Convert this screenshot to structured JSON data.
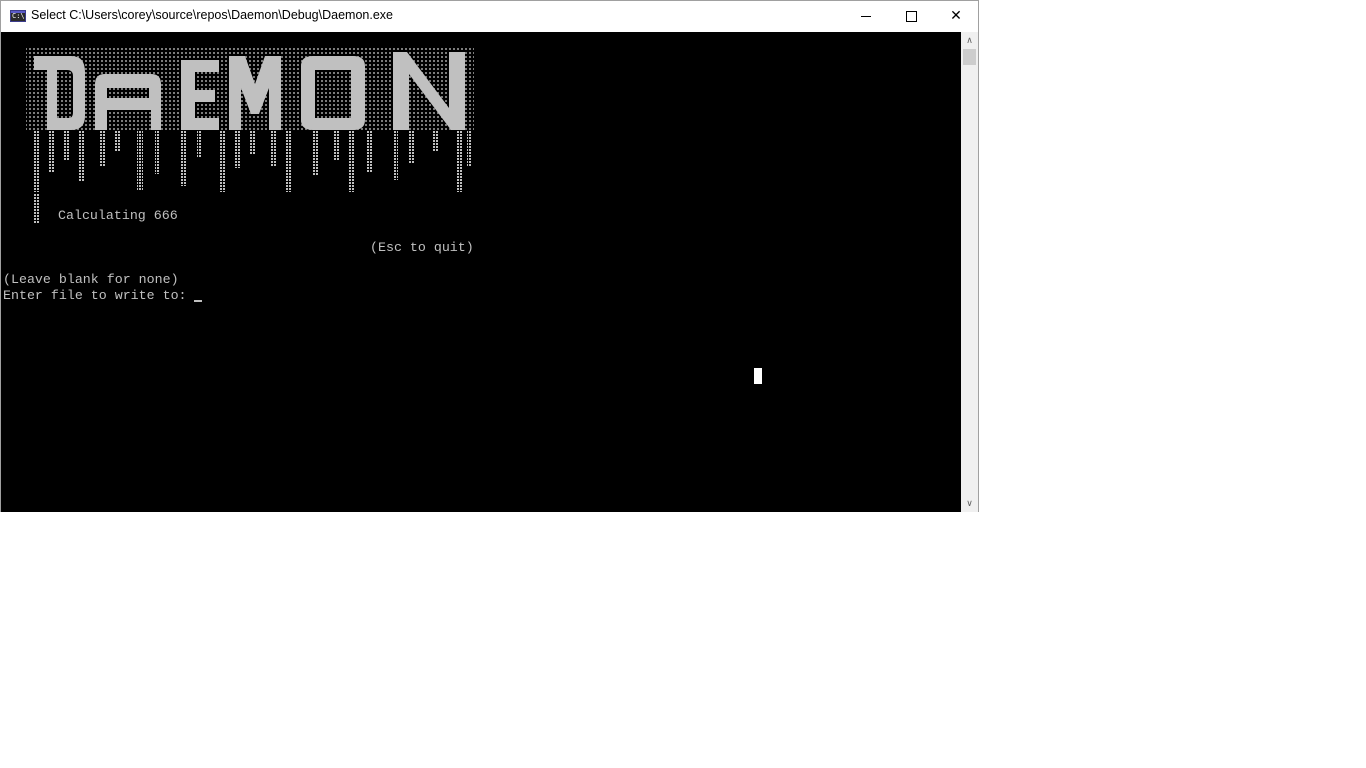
{
  "window": {
    "title": "Select C:\\Users\\corey\\source\\repos\\Daemon\\Debug\\Daemon.exe",
    "icon": "C:\\",
    "controls": {
      "minimize": "minimize-icon",
      "maximize": "maximize-icon",
      "close": "✕"
    }
  },
  "console": {
    "logo_text": "DAEMON",
    "status_line": "Calculating 666",
    "quit_hint": "(Esc to quit)",
    "blank_hint": "(Leave blank for none)",
    "prompt": "Enter file to write to: "
  },
  "colors": {
    "console_bg": "#000000",
    "console_text": "#c0c0c0",
    "logo": "#c0c0c0"
  },
  "scrollbar": {
    "up": "∧",
    "down": "∨"
  }
}
